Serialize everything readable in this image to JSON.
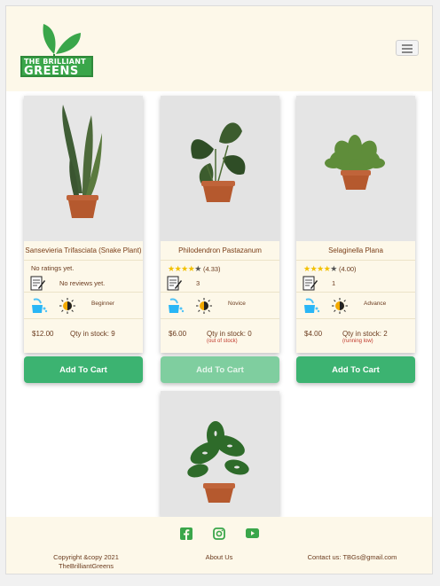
{
  "brand": {
    "line1": "THE BRILLIANT",
    "line2": "GREENS"
  },
  "products": [
    {
      "name": "Sansevieria Trifasciata (Snake Plant)",
      "rating_text": "No ratings yet.",
      "stars": 0,
      "reviews": "No reviews yet.",
      "level": "Beginner",
      "price": "$12.00",
      "qty": "Qty in stock: 9",
      "stock_note": "",
      "cart_label": "Add To Cart",
      "cart_enabled": true
    },
    {
      "name": "Philodendron Pastazanum",
      "rating_text": "(4.33)",
      "stars": 4.33,
      "reviews": "3",
      "level": "Novice",
      "price": "$6.00",
      "qty": "Qty in stock: 0",
      "stock_note": "(out of stock)",
      "cart_label": "Add To Cart",
      "cart_enabled": false
    },
    {
      "name": "Selaginella Plana",
      "rating_text": "(4.00)",
      "stars": 4,
      "reviews": "1",
      "level": "Advance",
      "price": "$4.00",
      "qty": "Qty in stock: 2",
      "stock_note": "(running low)",
      "cart_label": "Add To Cart",
      "cart_enabled": true
    }
  ],
  "footer": {
    "copyright_line1": "Copyright &copy 2021",
    "copyright_line2": "TheBrilliantGreens",
    "about": "About Us",
    "contact": "Contact us: TBGs@gmail.com",
    "social": [
      "facebook-icon",
      "instagram-icon",
      "youtube-icon"
    ]
  },
  "colors": {
    "accent": "#3cb371",
    "cream": "#fdf8e9",
    "text": "#6b3b1e",
    "warn": "#c0392b"
  }
}
